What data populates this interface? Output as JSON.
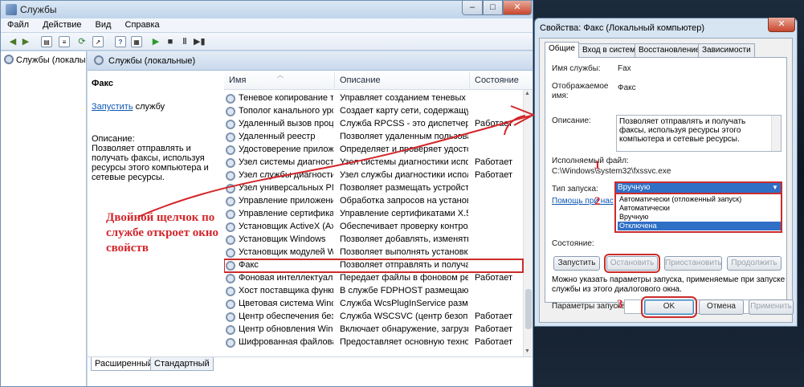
{
  "services_window": {
    "title": "Службы",
    "controls": {
      "minimize": "–",
      "maximize": "□",
      "close": "✕"
    },
    "menu": [
      "Файл",
      "Действие",
      "Вид",
      "Справка"
    ],
    "toolbar_icons": [
      "back-arrow-icon",
      "forward-arrow-icon",
      "console-tree-icon",
      "properties-icon",
      "refresh-icon",
      "export-icon",
      "help-icon",
      "console-icon",
      "play-icon",
      "stop-icon",
      "pause-icon",
      "restart-icon"
    ],
    "tree_item": "Службы (локалы",
    "header": "Службы (локальные)",
    "selected_service": {
      "name": "Факс",
      "start_link": "Запустить",
      "start_suffix": " службу",
      "desc_label": "Описание:",
      "desc_text": "Позволяет отправлять и получать факсы, используя ресурсы этого компьютера и сетевые ресурсы."
    },
    "columns": {
      "name": "Имя",
      "description": "Описание",
      "status": "Состояние"
    },
    "rows": [
      {
        "name": "Теневое копирование то...",
        "description": "Управляет созданием теневых ко...",
        "status": ""
      },
      {
        "name": "Тополог канального уро...",
        "description": "Создает карту сети, содержащую ...",
        "status": ""
      },
      {
        "name": "Удаленный вызов проце...",
        "description": "Служба RPCSS - это диспетчер ст...",
        "status": "Работает"
      },
      {
        "name": "Удаленный реестр",
        "description": "Позволяет удаленным пользоват...",
        "status": ""
      },
      {
        "name": "Удостоверение приложе...",
        "description": "Определяет и проверяет удостов...",
        "status": ""
      },
      {
        "name": "Узел системы диагности...",
        "description": "Узел системы диагностики испол...",
        "status": "Работает"
      },
      {
        "name": "Узел службы диагностики",
        "description": "Узел службы диагностики исполь...",
        "status": "Работает"
      },
      {
        "name": "Узел универсальных PNP...",
        "description": "Позволяет размещать устройства...",
        "status": ""
      },
      {
        "name": "Управление приложения...",
        "description": "Обработка запросов на установк...",
        "status": ""
      },
      {
        "name": "Управление сертификата...",
        "description": "Управление сертификатами X.509 ...",
        "status": ""
      },
      {
        "name": "Установщик ActiveX (AxI...",
        "description": "Обеспечивает проверку контрол...",
        "status": ""
      },
      {
        "name": "Установщик Windows",
        "description": "Позволяет добавлять, изменять ...",
        "status": ""
      },
      {
        "name": "Установщик модулей Wi...",
        "description": "Позволяет выполнять установку, ...",
        "status": ""
      },
      {
        "name": "Факс",
        "description": "Позволяет отправлять и получат...",
        "status": ""
      },
      {
        "name": "Фоновая интеллектуаль...",
        "description": "Передает файлы в фоновом реж...",
        "status": "Работает"
      },
      {
        "name": "Хост поставщика функц...",
        "description": "В службе FDPHOST размещаются ...",
        "status": ""
      },
      {
        "name": "Цветовая система Windo...",
        "description": "Служба WcsPlugInService размещ...",
        "status": ""
      },
      {
        "name": "Центр обеспечения безо...",
        "description": "Служба WSCSVC (центр безопасн...",
        "status": "Работает"
      },
      {
        "name": "Центр обновления Wind...",
        "description": "Включает обнаружение, загрузку...",
        "status": "Работает"
      },
      {
        "name": "Шифрованная файловая ...",
        "description": "Предоставляет основную технол...",
        "status": "Работает"
      }
    ],
    "tabs": [
      "Расширенный",
      "Стандартный"
    ]
  },
  "annotation": {
    "text": "Двойной щелчок по службе откроет окно свойств",
    "color": "#d3262b",
    "numbers": [
      "1",
      "2",
      "3"
    ]
  },
  "properties_dialog": {
    "title": "Свойства: Факс (Локальный компьютер)",
    "close": "✕",
    "tabs": [
      "Общие",
      "Вход в систему",
      "Восстановление",
      "Зависимости"
    ],
    "service_name_label": "Имя службы:",
    "service_name": "Fax",
    "display_name_label": "Отображаемое имя:",
    "display_name": "Факс",
    "description_label": "Описание:",
    "description": "Позволяет отправлять и получать факсы, используя ресурсы этого компьютера и сетевые ресурсы.",
    "exe_label": "Исполняемый файл:",
    "exe_path": "C:\\Windows\\system32\\fxssvc.exe",
    "startup_label": "Тип запуска:",
    "startup_value": "Вручную",
    "startup_options": [
      "Автоматически (отложенный запуск)",
      "Автоматически",
      "Вручную",
      "Отключена"
    ],
    "help_link": "Помощь при нас",
    "state_label": "Состояние:",
    "buttons": {
      "start": "Запустить",
      "stop": "Остановить",
      "pause": "Приостановить",
      "resume": "Продолжить"
    },
    "params_note": "Можно указать параметры запуска, применяемые при запуске службы из этого диалогового окна.",
    "params_label": "Параметры запуска:",
    "params_value": "",
    "ok": "OK",
    "cancel": "Отмена",
    "apply": "Применить"
  }
}
